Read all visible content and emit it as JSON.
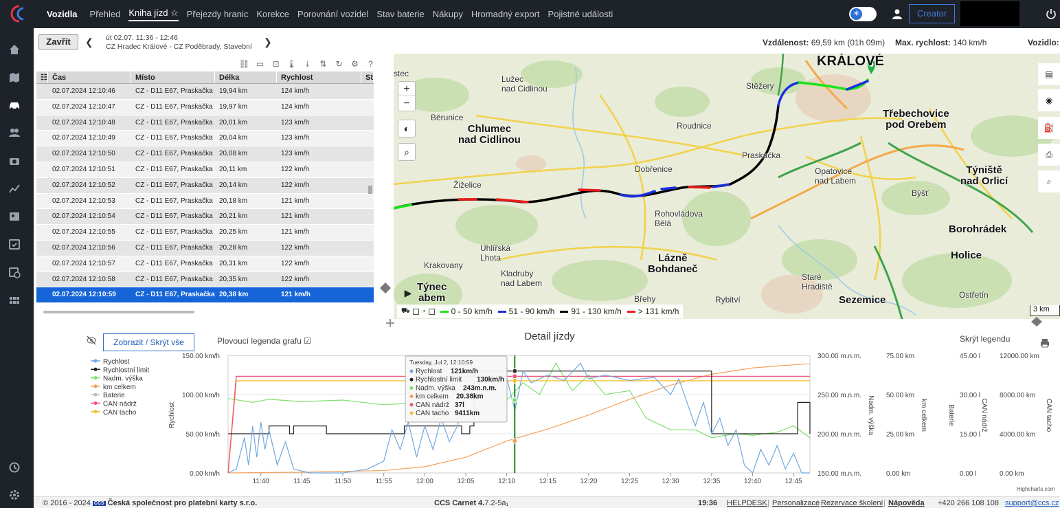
{
  "topbar": {
    "brand": "Vozidla",
    "nav": [
      "Přehled",
      "Kniha jízd ☆",
      "Přejezdy hranic",
      "Korekce",
      "Porovnání vozidel",
      "Stav baterie",
      "Nákupy",
      "Hromadný export",
      "Pojistné události"
    ],
    "active_index": 1,
    "creator_label": "Creator"
  },
  "sidebar": {
    "icons": [
      "home-icon",
      "map-icon",
      "car-icon",
      "people-icon",
      "camera-icon",
      "chart-icon",
      "contacts-icon",
      "calendar-check-icon",
      "calendar-clock-icon",
      "grid-icon",
      "history-icon",
      "settings-icon"
    ]
  },
  "trip": {
    "close_label": "Zavřít",
    "line1": "út 02.07. 11:36 - 12:46",
    "line2": "CZ Hradec Králové - CZ Poděbrady, Stavební",
    "distance_label": "Vzdálenost:",
    "distance_value": "69,59 km (01h 09m)",
    "maxspeed_label": "Max. rychlost:",
    "maxspeed_value": "140 km/h",
    "vehicle_label": "Vozidlo:"
  },
  "table": {
    "columns": [
      "",
      "Čas",
      "Místo",
      "Délka",
      "Rychlost",
      "Sta"
    ],
    "rows": [
      [
        "02.07.2024 12:10:46",
        "CZ - D11 E67, Praskačka",
        "19,94 km",
        "124 km/h"
      ],
      [
        "02.07.2024 12:10:47",
        "CZ - D11 E67, Praskačka",
        "19,97 km",
        "124 km/h"
      ],
      [
        "02.07.2024 12:10:48",
        "CZ - D11 E67, Praskačka",
        "20,01 km",
        "123 km/h"
      ],
      [
        "02.07.2024 12:10:49",
        "CZ - D11 E67, Praskačka",
        "20,04 km",
        "123 km/h"
      ],
      [
        "02.07.2024 12:10:50",
        "CZ - D11 E67, Praskačka",
        "20,08 km",
        "123 km/h"
      ],
      [
        "02.07.2024 12:10:51",
        "CZ - D11 E67, Praskačka",
        "20,11 km",
        "122 km/h"
      ],
      [
        "02.07.2024 12:10:52",
        "CZ - D11 E67, Praskačka",
        "20,14 km",
        "122 km/h"
      ],
      [
        "02.07.2024 12:10:53",
        "CZ - D11 E67, Praskačka",
        "20,18 km",
        "121 km/h"
      ],
      [
        "02.07.2024 12:10:54",
        "CZ - D11 E67, Praskačka",
        "20,21 km",
        "121 km/h"
      ],
      [
        "02.07.2024 12:10:55",
        "CZ - D11 E67, Praskačka",
        "20,25 km",
        "121 km/h"
      ],
      [
        "02.07.2024 12:10:56",
        "CZ - D11 E67, Praskačka",
        "20,28 km",
        "122 km/h"
      ],
      [
        "02.07.2024 12:10:57",
        "CZ - D11 E67, Praskačka",
        "20,31 km",
        "122 km/h"
      ],
      [
        "02.07.2024 12:10:58",
        "CZ - D11 E67, Praskačka",
        "20,35 km",
        "122 km/h"
      ],
      [
        "02.07.2024 12:10:59",
        "CZ - D11 E67, Praskačka",
        "20,38 km",
        "121 km/h"
      ]
    ],
    "selected_index": 13
  },
  "map": {
    "places": [
      {
        "name": "stec",
        "cls": ""
      },
      {
        "name": "Lužec\nnad Cidlinou",
        "cls": ""
      },
      {
        "name": "Stěžery",
        "cls": ""
      },
      {
        "name": "KRÁLOVÉ",
        "cls": "big"
      },
      {
        "name": "Třebechovice\npod Orebem",
        "cls": "city"
      },
      {
        "name": "Běrunice",
        "cls": ""
      },
      {
        "name": "Chlumec\nnad Cidlinou",
        "cls": "city"
      },
      {
        "name": "Roudnice",
        "cls": ""
      },
      {
        "name": "Dobřenice",
        "cls": ""
      },
      {
        "name": "Praskačka",
        "cls": ""
      },
      {
        "name": "Opatovice\nnad Labem",
        "cls": ""
      },
      {
        "name": "Týniště\nnad Orlicí",
        "cls": "city"
      },
      {
        "name": "Žiželice",
        "cls": ""
      },
      {
        "name": "Býšť",
        "cls": ""
      },
      {
        "name": "Rohovládova\nBělá",
        "cls": ""
      },
      {
        "name": "Borohrádek",
        "cls": "city"
      },
      {
        "name": "Uhlířská\nLhota",
        "cls": ""
      },
      {
        "name": "Krakovany",
        "cls": ""
      },
      {
        "name": "Lázně\nBohdaneč",
        "cls": "city"
      },
      {
        "name": "Holice",
        "cls": "city"
      },
      {
        "name": "Kladruby\nnad Labem",
        "cls": ""
      },
      {
        "name": "Staré\nHradiště",
        "cls": ""
      },
      {
        "name": "Týnec\nabem",
        "cls": "city"
      },
      {
        "name": "Břehy",
        "cls": ""
      },
      {
        "name": "Rybitví",
        "cls": ""
      },
      {
        "name": "Sezemice",
        "cls": "city"
      },
      {
        "name": "Ostřetín",
        "cls": ""
      }
    ],
    "legend": [
      {
        "label": "0 - 50 km/h",
        "color": "#19e619"
      },
      {
        "label": "51 - 90 km/h",
        "color": "#1a2fe0"
      },
      {
        "label": "91 - 130 km/h",
        "color": "#000000"
      },
      {
        "label": "> 131 km/h",
        "color": "#e81b1b"
      }
    ],
    "scale": "3 km",
    "zoom_in": "+",
    "zoom_out": "−"
  },
  "chart_section": {
    "toggle_label": "Zobrazit / Skrýt vše",
    "floating_legend": "Plovoucí legenda grafu ☑",
    "title": "Detail jízdy",
    "hide_legend": "Skrýt legendu",
    "credit": "Highcharts.com"
  },
  "chart_data": {
    "type": "line",
    "x_ticks": [
      "11:40",
      "11:45",
      "11:50",
      "11:55",
      "12:00",
      "12:05",
      "12:10",
      "12:15",
      "12:20",
      "12:25",
      "12:30",
      "12:35",
      "12:40",
      "12:45"
    ],
    "x_range_minutes": [
      11.36,
      12.47
    ],
    "cursor_time": "12:10:59",
    "legend_series": [
      {
        "name": "Rychlost",
        "color": "#6fa8e0"
      },
      {
        "name": "Rychlostní limit",
        "color": "#222222"
      },
      {
        "name": "Nadm. výška",
        "color": "#7ee06a"
      },
      {
        "name": "km celkem",
        "color": "#f4a05a"
      },
      {
        "name": "Baterie",
        "color": "#bbbbbb"
      },
      {
        "name": "CAN nádrž",
        "color": "#ee5577"
      },
      {
        "name": "CAN tacho",
        "color": "#f0c030"
      }
    ],
    "axes": [
      {
        "label": "Rychlost",
        "ticks": [
          "150.00 km/h",
          "100.00 km/h",
          "50.00 km/h",
          "0.00 km/h"
        ],
        "range": [
          0,
          150
        ]
      },
      {
        "label": "Nadm. výška",
        "ticks": [
          "300.00 m.n.m.",
          "250.00 m.n.m.",
          "200.00 m.n.m.",
          "150.00 m.n.m."
        ],
        "range": [
          150,
          300
        ]
      },
      {
        "label": "km celkem",
        "ticks": [
          "75.00 km",
          "50.00 km",
          "25.00 km",
          "0.00 km"
        ],
        "range": [
          0,
          75
        ]
      },
      {
        "label": "Baterie",
        "ticks": [],
        "range": []
      },
      {
        "label": "CAN nádrž",
        "ticks": [
          "45.00 l",
          "30.00 l",
          "15.00 l",
          "0.00 l"
        ],
        "range": [
          0,
          45
        ]
      },
      {
        "label": "CAN tacho",
        "ticks": [
          "12000.00 km",
          "8000.00 km",
          "4000.00 km",
          "0.00 km"
        ],
        "range": [
          0,
          12000
        ]
      }
    ],
    "speed_limit": [
      [
        11.36,
        50
      ],
      [
        11.4,
        50
      ],
      [
        11.41,
        60
      ],
      [
        11.43,
        60
      ],
      [
        11.435,
        50
      ],
      [
        11.44,
        60
      ],
      [
        11.47,
        60
      ],
      [
        11.48,
        50
      ],
      [
        11.57,
        50
      ],
      [
        11.575,
        60
      ],
      [
        12.04,
        60
      ],
      [
        12.045,
        50
      ],
      [
        12.05,
        50
      ],
      [
        12.055,
        60
      ],
      [
        12.06,
        130
      ],
      [
        12.345,
        130
      ],
      [
        12.35,
        50
      ],
      [
        12.45,
        50
      ],
      [
        12.455,
        90
      ],
      [
        12.465,
        90
      ],
      [
        12.47,
        50
      ]
    ],
    "can_tacho": [
      [
        11.36,
        0
      ],
      [
        11.37,
        9411
      ],
      [
        12.47,
        9411
      ]
    ],
    "can_nadrz": [
      [
        11.36,
        0
      ],
      [
        11.37,
        37
      ],
      [
        12.47,
        37
      ]
    ],
    "km_celkem": [
      [
        11.36,
        0
      ],
      [
        11.45,
        0.5
      ],
      [
        11.55,
        1.5
      ],
      [
        12.0,
        4
      ],
      [
        12.05,
        10
      ],
      [
        12.1,
        20.38
      ],
      [
        12.15,
        28
      ],
      [
        12.2,
        37
      ],
      [
        12.25,
        47
      ],
      [
        12.3,
        56
      ],
      [
        12.35,
        63
      ],
      [
        12.4,
        67
      ],
      [
        12.45,
        69
      ],
      [
        12.47,
        69.59
      ]
    ],
    "altitude": [
      [
        11.36,
        245
      ],
      [
        11.39,
        240
      ],
      [
        11.41,
        244
      ],
      [
        11.45,
        241
      ],
      [
        11.5,
        243
      ],
      [
        11.55,
        237
      ],
      [
        12.0,
        240
      ],
      [
        12.02,
        225
      ],
      [
        12.05,
        245
      ],
      [
        12.07,
        240
      ],
      [
        12.1,
        243
      ],
      [
        12.12,
        265
      ],
      [
        12.14,
        250
      ],
      [
        12.16,
        290
      ],
      [
        12.18,
        255
      ],
      [
        12.2,
        275
      ],
      [
        12.22,
        250
      ],
      [
        12.25,
        255
      ],
      [
        12.27,
        220
      ],
      [
        12.3,
        205
      ],
      [
        12.33,
        205
      ],
      [
        12.35,
        195
      ],
      [
        12.38,
        200
      ],
      [
        12.4,
        198
      ],
      [
        12.43,
        202
      ],
      [
        12.45,
        210
      ],
      [
        12.47,
        195
      ]
    ],
    "speed": [
      [
        11.36,
        0
      ],
      [
        11.37,
        5
      ],
      [
        11.38,
        45
      ],
      [
        11.385,
        10
      ],
      [
        11.39,
        60
      ],
      [
        11.395,
        20
      ],
      [
        11.4,
        65
      ],
      [
        11.405,
        30
      ],
      [
        11.41,
        55
      ],
      [
        11.42,
        10
      ],
      [
        11.43,
        40
      ],
      [
        11.44,
        5
      ],
      [
        11.46,
        0
      ],
      [
        11.5,
        0
      ],
      [
        11.53,
        5
      ],
      [
        11.55,
        15
      ],
      [
        11.56,
        55
      ],
      [
        11.57,
        30
      ],
      [
        11.58,
        65
      ],
      [
        11.59,
        20
      ],
      [
        12.0,
        60
      ],
      [
        12.01,
        30
      ],
      [
        12.02,
        70
      ],
      [
        12.03,
        40
      ],
      [
        12.04,
        60
      ],
      [
        12.05,
        110
      ],
      [
        12.06,
        125
      ],
      [
        12.07,
        130
      ],
      [
        12.08,
        120
      ],
      [
        12.09,
        125
      ],
      [
        12.1,
        121
      ],
      [
        12.11,
        80
      ],
      [
        12.12,
        130
      ],
      [
        12.13,
        115
      ],
      [
        12.15,
        125
      ],
      [
        12.17,
        118
      ],
      [
        12.19,
        140
      ],
      [
        12.2,
        120
      ],
      [
        12.22,
        125
      ],
      [
        12.25,
        118
      ],
      [
        12.28,
        122
      ],
      [
        12.3,
        100
      ],
      [
        12.31,
        120
      ],
      [
        12.33,
        60
      ],
      [
        12.34,
        90
      ],
      [
        12.35,
        50
      ],
      [
        12.36,
        70
      ],
      [
        12.37,
        35
      ],
      [
        12.38,
        55
      ],
      [
        12.39,
        10
      ],
      [
        12.4,
        0
      ],
      [
        12.41,
        30
      ],
      [
        12.42,
        10
      ],
      [
        12.43,
        35
      ],
      [
        12.44,
        5
      ],
      [
        12.45,
        25
      ],
      [
        12.46,
        0
      ],
      [
        12.47,
        0
      ]
    ],
    "tooltip": {
      "header": "Tuesday, Jul 2, 12:10:59",
      "rows": [
        {
          "label": "Rychlost",
          "value": "121km/h",
          "color": "#6fa8e0"
        },
        {
          "label": "Rychlostní limit",
          "value": "130km/h",
          "color": "#222222"
        },
        {
          "label": "Nadm. výška",
          "value": "243m.n.m.",
          "color": "#7ee06a"
        },
        {
          "label": "km celkem",
          "value": "20.38km",
          "color": "#f4a05a"
        },
        {
          "label": "CAN nádrž",
          "value": "37l",
          "color": "#ee5577"
        },
        {
          "label": "CAN tacho",
          "value": "9411km",
          "color": "#f0c030"
        }
      ]
    }
  },
  "footer": {
    "copyright": "© 2016 - 2024",
    "badge": "CCS",
    "company": "Česká společnost pro platební karty s.r.o.",
    "app": "CCS Carnet 4.",
    "version": "7.2-5a₁",
    "time": "19:36",
    "links": [
      "HELPDESK",
      "Personalizace",
      "Rezervace školení",
      "Nápověda"
    ],
    "phone": "+420 266 108 108",
    "email": "support@ccs.cz"
  }
}
